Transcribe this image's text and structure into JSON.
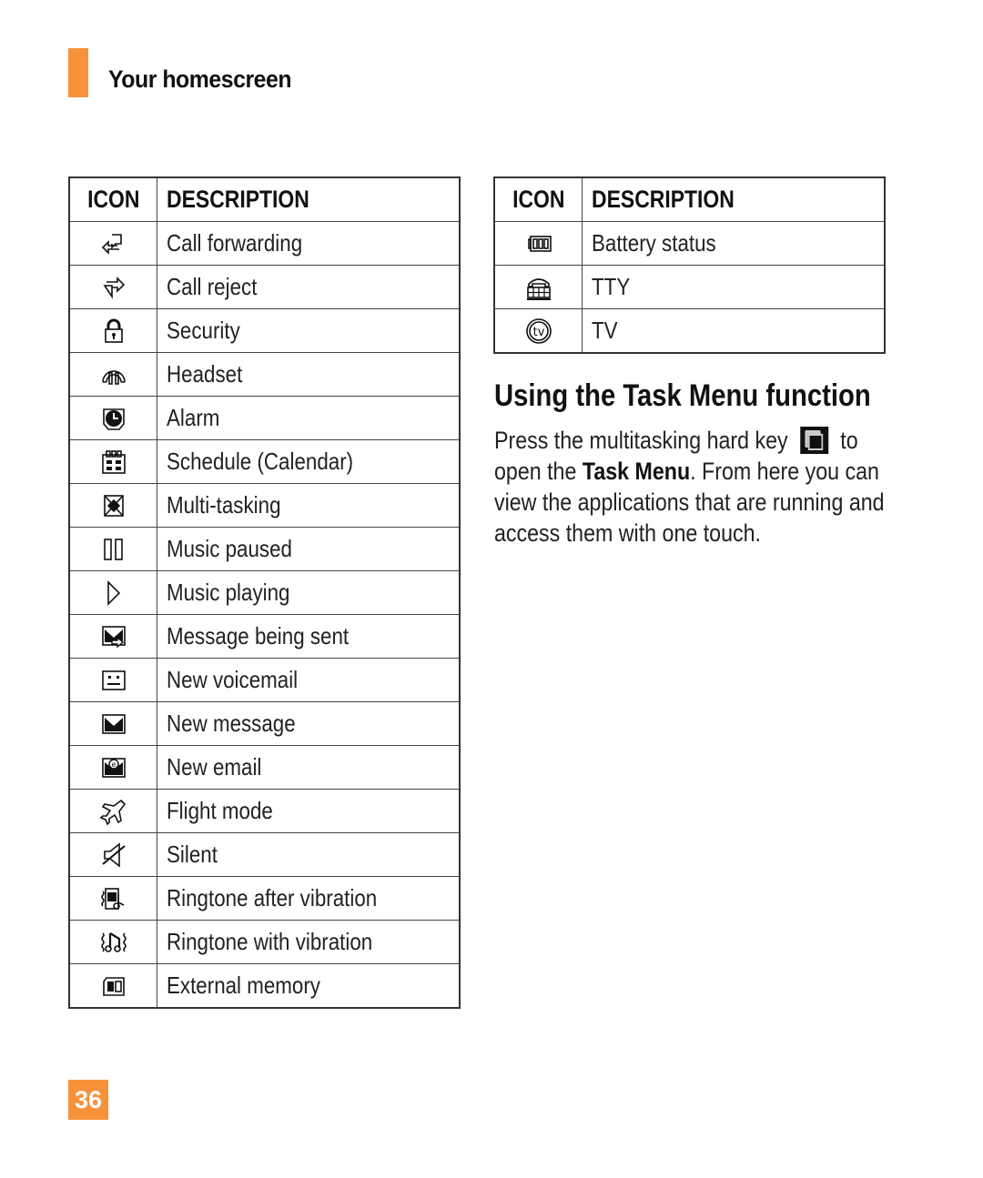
{
  "header": {
    "title": "Your homescreen",
    "accent_color": "#f7923a"
  },
  "left_table": {
    "columns": [
      "ICON",
      "DESCRIPTION"
    ],
    "rows": [
      {
        "icon": "call-forwarding-icon",
        "description": "Call forwarding"
      },
      {
        "icon": "call-reject-icon",
        "description": "Call reject"
      },
      {
        "icon": "security-lock-icon",
        "description": "Security"
      },
      {
        "icon": "headset-icon",
        "description": "Headset"
      },
      {
        "icon": "alarm-clock-icon",
        "description": "Alarm"
      },
      {
        "icon": "calendar-icon",
        "description": "Schedule (Calendar)"
      },
      {
        "icon": "multitasking-icon",
        "description": "Multi-tasking"
      },
      {
        "icon": "pause-icon",
        "description": "Music paused"
      },
      {
        "icon": "play-icon",
        "description": "Music playing"
      },
      {
        "icon": "message-sending-icon",
        "description": "Message being sent"
      },
      {
        "icon": "voicemail-icon",
        "description": "New voicemail"
      },
      {
        "icon": "envelope-icon",
        "description": "New message"
      },
      {
        "icon": "email-icon",
        "description": "New email"
      },
      {
        "icon": "airplane-icon",
        "description": "Flight mode"
      },
      {
        "icon": "speaker-muted-icon",
        "description": "Silent"
      },
      {
        "icon": "ringtone-after-vibration-icon",
        "description": "Ringtone after vibration"
      },
      {
        "icon": "ringtone-with-vibration-icon",
        "description": "Ringtone with vibration"
      },
      {
        "icon": "memory-card-icon",
        "description": "External memory"
      }
    ]
  },
  "right_table": {
    "columns": [
      "ICON",
      "DESCRIPTION"
    ],
    "rows": [
      {
        "icon": "battery-icon",
        "description": "Battery status"
      },
      {
        "icon": "tty-icon",
        "description": "TTY"
      },
      {
        "icon": "tv-icon",
        "description": "TV"
      }
    ]
  },
  "task_menu": {
    "title": "Using the Task Menu function",
    "body_before_key": "Press the multitasking hard key",
    "hard_key_icon": "multitasking-hard-key-icon",
    "body_after_key": "to open the",
    "bold_term": "Task Menu",
    "body_end": ". From here you can view the applications that are running and access them with one touch."
  },
  "footer": {
    "page_number": "36"
  }
}
